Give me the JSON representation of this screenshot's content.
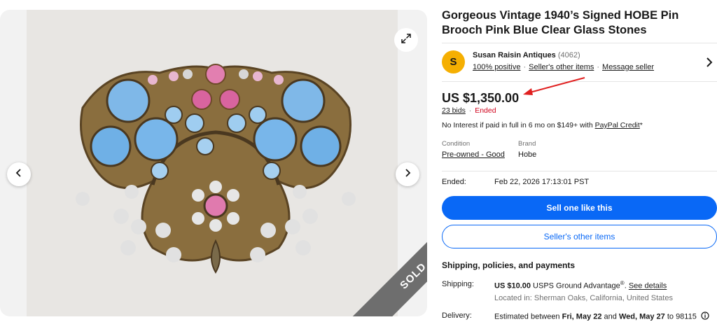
{
  "listing": {
    "title": "Gorgeous Vintage 1940’s Signed HOBE Pin Brooch Pink Blue Clear Glass Stones",
    "sold_badge": "SOLD"
  },
  "seller": {
    "avatar_letter": "S",
    "name": "Susan Raisin Antiques",
    "feedback_count": "(4062)",
    "positive_link": "100% positive",
    "other_items_link": "Seller's other items",
    "message_link": "Message seller"
  },
  "price": {
    "amount": "US $1,350.00",
    "bids": "23 bids",
    "separator": "·",
    "status": "Ended",
    "financing_text": "No Interest if paid in full in 6 mo on $149+ with ",
    "financing_link": "PayPal Credit",
    "financing_suffix": "*"
  },
  "specs": {
    "condition_label": "Condition",
    "condition_value": "Pre-owned - Good",
    "brand_label": "Brand",
    "brand_value": "Hobe"
  },
  "ended": {
    "label": "Ended:",
    "value": "Feb 22, 2026 17:13:01 PST"
  },
  "actions": {
    "primary": "Sell one like this",
    "secondary": "Seller's other items"
  },
  "shipping": {
    "heading": "Shipping, policies, and payments",
    "label": "Shipping:",
    "cost": "US $10.00",
    "service": " USPS Ground Advantage",
    "service_mark": "®",
    "see_details": "See details",
    "location": "Located in: Sherman Oaks, California, United States",
    "delivery_label": "Delivery:",
    "delivery_prefix": "Estimated between ",
    "delivery_start": "Fri, May 22",
    "delivery_and": " and ",
    "delivery_end": "Wed, May 27",
    "delivery_to": " to 98115"
  },
  "colors": {
    "primary_blue": "#0968f6",
    "ended_red": "#d0021b",
    "avatar_yellow": "#f5af02",
    "annotation_arrow": "#e02020"
  },
  "icons": {
    "prev": "chevron-left-icon",
    "next": "chevron-right-icon",
    "expand": "expand-icon",
    "seller_chevron": "chevron-right-icon",
    "info": "info-icon"
  }
}
